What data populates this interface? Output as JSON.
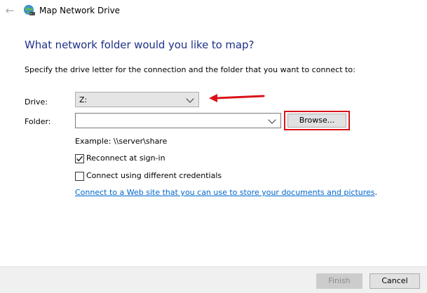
{
  "window": {
    "title": "Map Network Drive",
    "back_icon": "back-arrow-icon",
    "app_icon": "network-drive-icon"
  },
  "dialog": {
    "heading": "What network folder would you like to map?",
    "instruction": "Specify the drive letter for the connection and the folder that you want to connect to:"
  },
  "drive": {
    "label": "Drive:",
    "selected": "Z:"
  },
  "folder": {
    "label": "Folder:",
    "value": "",
    "browse_label": "Browse..."
  },
  "example_text": "Example: \\\\server\\share",
  "options": {
    "reconnect": {
      "label": "Reconnect at sign-in",
      "checked": true
    },
    "different_credentials": {
      "label": "Connect using different credentials",
      "checked": false
    }
  },
  "link": {
    "text": "Connect to a Web site that you can use to store your documents and pictures",
    "trailing": "."
  },
  "footer": {
    "finish_label": "Finish",
    "cancel_label": "Cancel"
  },
  "colors": {
    "heading": "#1e3287",
    "link": "#0066cc",
    "annotation_red": "#d8141a"
  }
}
